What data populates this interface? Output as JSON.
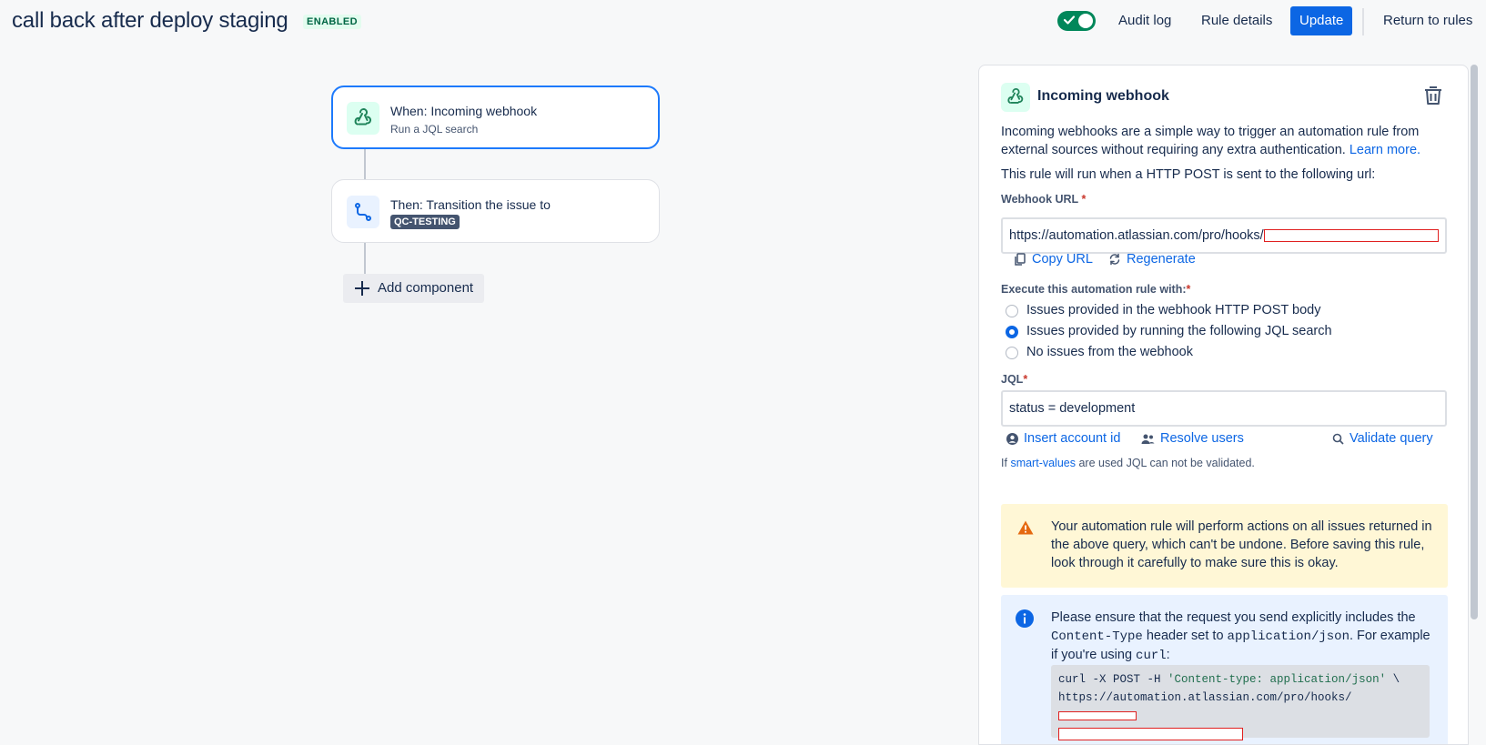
{
  "header": {
    "title": "call back after deploy staging",
    "status": "ENABLED",
    "toggle_on": true,
    "audit_log": "Audit log",
    "rule_details": "Rule details",
    "update": "Update",
    "return": "Return to rules"
  },
  "canvas": {
    "trigger": {
      "title": "When: Incoming webhook",
      "subtitle": "Run a JQL search",
      "icon": "webhook-icon"
    },
    "action": {
      "title": "Then: Transition the issue to",
      "badge": "QC-TESTING",
      "icon": "transition-icon"
    },
    "add_component": "Add component"
  },
  "panel": {
    "title": "Incoming webhook",
    "description": "Incoming webhooks are a simple way to trigger an automation rule from external sources without requiring any extra authentication.",
    "learn_more": "Learn more.",
    "run_text": "This rule will run when a HTTP POST is sent to the following url:",
    "webhook_label": "Webhook URL",
    "webhook_url": "https://automation.atlassian.com/pro/hooks/",
    "copy_url": "Copy URL",
    "regenerate": "Regenerate",
    "execute_label": "Execute this automation rule with:",
    "options": [
      {
        "label": "Issues provided in the webhook HTTP POST body",
        "selected": false
      },
      {
        "label": "Issues provided by running the following JQL search",
        "selected": true
      },
      {
        "label": "No issues from the webhook",
        "selected": false
      }
    ],
    "jql_label": "JQL",
    "jql_value": "status = development",
    "insert_account_id": "Insert account id",
    "resolve_users": "Resolve users",
    "validate_query": "Validate query",
    "hint_prefix": "If",
    "hint_link": "smart-values",
    "hint_suffix": "are used JQL can not be validated.",
    "warning": "Your automation rule will perform actions on all issues returned in the above query, which can't be undone. Before saving this rule, look through it carefully to make sure this is okay.",
    "info_1": "Please ensure that the request you send explicitly includes the",
    "info_code_1": "Content-Type",
    "info_2": "header set to",
    "info_code_2": "application/json",
    "info_3": ". For example if you're using",
    "info_code_3": "curl",
    "info_4": ":",
    "curl_line1_a": "curl -X POST -H ",
    "curl_line1_str": "'Content-type: application/json'",
    "curl_line1_b": " \\",
    "curl_line2": "https://automation.atlassian.com/pro/hooks/"
  },
  "colors": {
    "primary": "#0c66e4",
    "success": "#00875a",
    "warning_bg": "#fff7d6",
    "info_bg": "#e9f2ff"
  }
}
